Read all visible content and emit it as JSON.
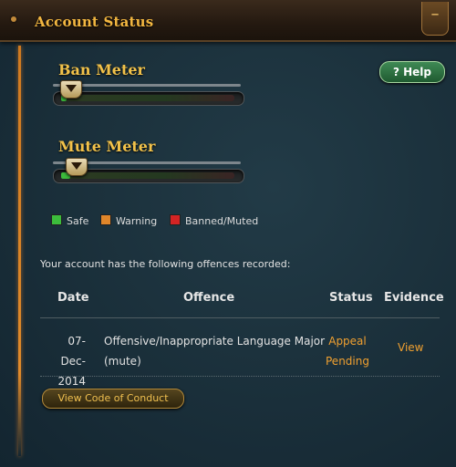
{
  "header": {
    "title": "Account Status",
    "collapse_icon": "minus-icon"
  },
  "help": {
    "label": "? Help"
  },
  "ban_meter": {
    "title": "Ban Meter",
    "level_percent": 5
  },
  "mute_meter": {
    "title": "Mute Meter",
    "level_percent": 10
  },
  "legend": [
    {
      "label": "Safe",
      "color": "#3cbc3c"
    },
    {
      "label": "Warning",
      "color": "#e0862a"
    },
    {
      "label": "Banned/Muted",
      "color": "#d42424"
    }
  ],
  "offences": {
    "intro": "Your account has the following offences recorded:",
    "headers": {
      "date": "Date",
      "offence": "Offence",
      "status": "Status",
      "evidence": "Evidence"
    },
    "rows": [
      {
        "date_line1": "07-Dec-",
        "date_line2": "2014",
        "offence_line1": "Offensive/Inappropriate Language Major",
        "offence_line2": "(mute)",
        "status_line1": "Appeal",
        "status_line2": "Pending",
        "evidence": "View"
      }
    ]
  },
  "conduct_button": {
    "label": "View Code of Conduct"
  },
  "colors": {
    "accent_gold": "#f2b640",
    "status_orange": "#f0a030",
    "panel_bg": "#1a2f3a"
  }
}
